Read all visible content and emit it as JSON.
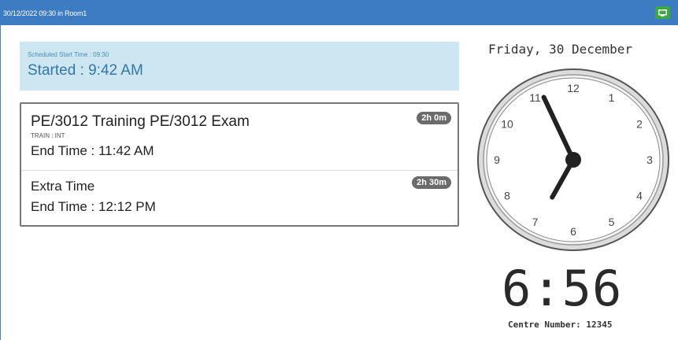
{
  "header": {
    "title": "30/12/2022 09:30 in Room1",
    "screen_icon": "monitor-icon",
    "accent_color": "#3d7cc2",
    "button_color": "#3aa843"
  },
  "schedule": {
    "scheduled_start": "Scheduled Start Time : 09:30",
    "started": "Started : 9:42 AM"
  },
  "exams": [
    {
      "title": "PE/3012 Training PE/3012 Exam",
      "code": "TRAIN : INT",
      "end_time": "End Time : 11:42 AM",
      "duration": "2h 0m"
    },
    {
      "title": "Extra Time",
      "end_time": "End Time : 12:12 PM",
      "duration": "2h 30m"
    }
  ],
  "clock": {
    "date": "Friday, 30 December",
    "hour": 6,
    "minute": 56,
    "numerals": [
      "12",
      "1",
      "2",
      "3",
      "4",
      "5",
      "6",
      "7",
      "8",
      "9",
      "10",
      "11"
    ],
    "digital": "6:56"
  },
  "footer": {
    "centre_number": "Centre Number: 12345"
  }
}
